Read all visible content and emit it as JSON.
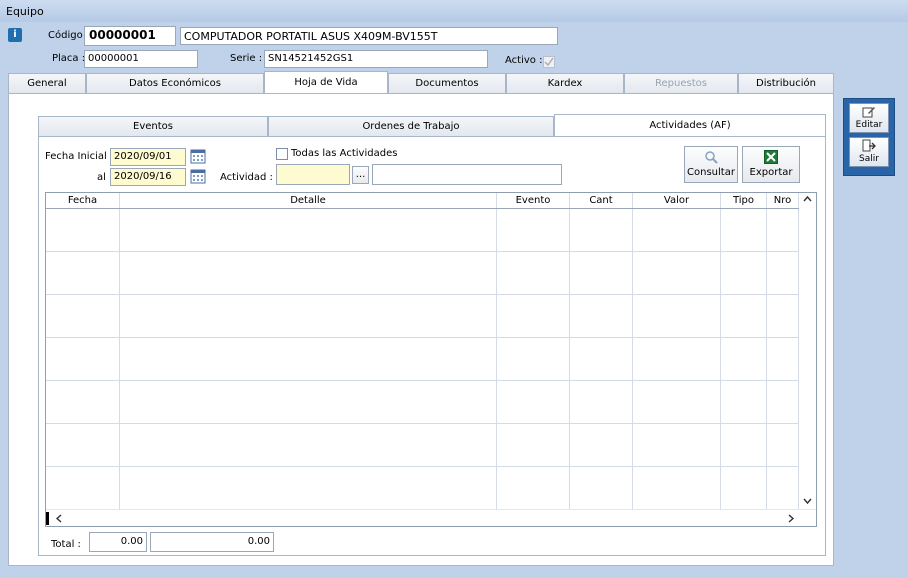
{
  "window": {
    "title": "Equipo"
  },
  "header": {
    "codigo_label": "Código :",
    "codigo_value": "00000001",
    "descripcion": "COMPUTADOR PORTATIL ASUS X409M-BV155T",
    "placa_label": "Placa :",
    "placa_value": "00000001",
    "serie_label": "Serie :",
    "serie_value": "SN14521452GS1",
    "activo_label": "Activo :"
  },
  "main_tabs": [
    "General",
    "Datos Económicos",
    "Hoja de Vida",
    "Documentos",
    "Kardex",
    "Repuestos",
    "Distribución"
  ],
  "sub_tabs": [
    "Eventos",
    "Ordenes de Trabajo",
    "Actividades (AF)"
  ],
  "filters": {
    "fecha_inicial_label": "Fecha Inicial :",
    "fecha_inicial": "2020/09/01",
    "al_label": "al",
    "fecha_final": "2020/09/16",
    "todas_label": "Todas las Actividades",
    "actividad_label": "Actividad :",
    "ellipsis": "..."
  },
  "actions": {
    "consultar": "Consultar",
    "exportar": "Exportar"
  },
  "grid": {
    "columns": [
      "Fecha",
      "Detalle",
      "Evento",
      "Cant",
      "Valor",
      "Tipo",
      "Nro"
    ],
    "rows": []
  },
  "totals": {
    "label": "Total :",
    "cant_total": "0.00",
    "valor_total": "0.00"
  },
  "sidebar": {
    "editar": "Editar",
    "salir": "Salir"
  },
  "colors": {
    "accent": "#2a64a8",
    "background": "#bfd2e9",
    "date_field": "#fffbd0"
  }
}
